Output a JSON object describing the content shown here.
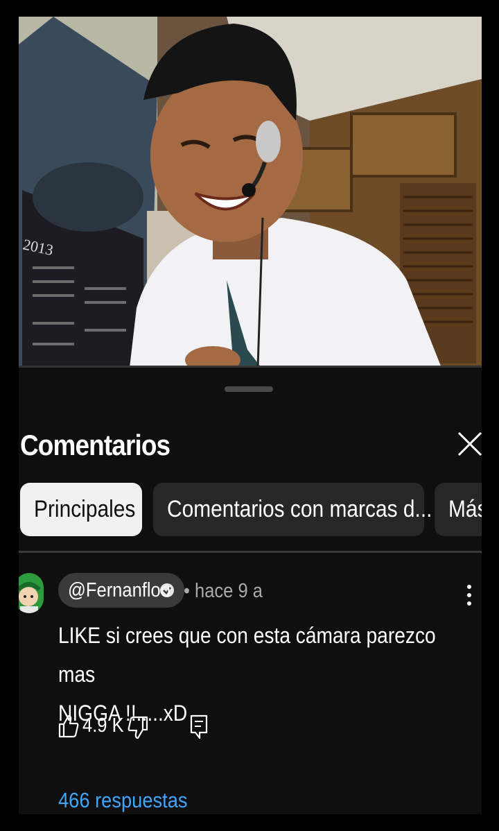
{
  "video": {
    "calendar_year": "2013"
  },
  "sheet": {
    "title": "Comentarios",
    "close_icon": "close-icon"
  },
  "chips": [
    {
      "label": "Principales",
      "selected": true
    },
    {
      "label": "Comentarios con marcas d...",
      "selected": false
    },
    {
      "label": "Más",
      "selected": false
    }
  ],
  "comment": {
    "author": "@Fernanfloo",
    "verified": true,
    "time": "• hace 9 a",
    "text_line1": "LIKE si crees que con esta cámara parezco mas",
    "text_line2": "NIGGA !!.....xD",
    "likes": "4.9 K",
    "replies": "466 respuestas"
  },
  "colors": {
    "background": "#0f0f0f",
    "chip_selected": "#f1f1f1",
    "chip": "#272727",
    "link": "#3ea6ff"
  }
}
